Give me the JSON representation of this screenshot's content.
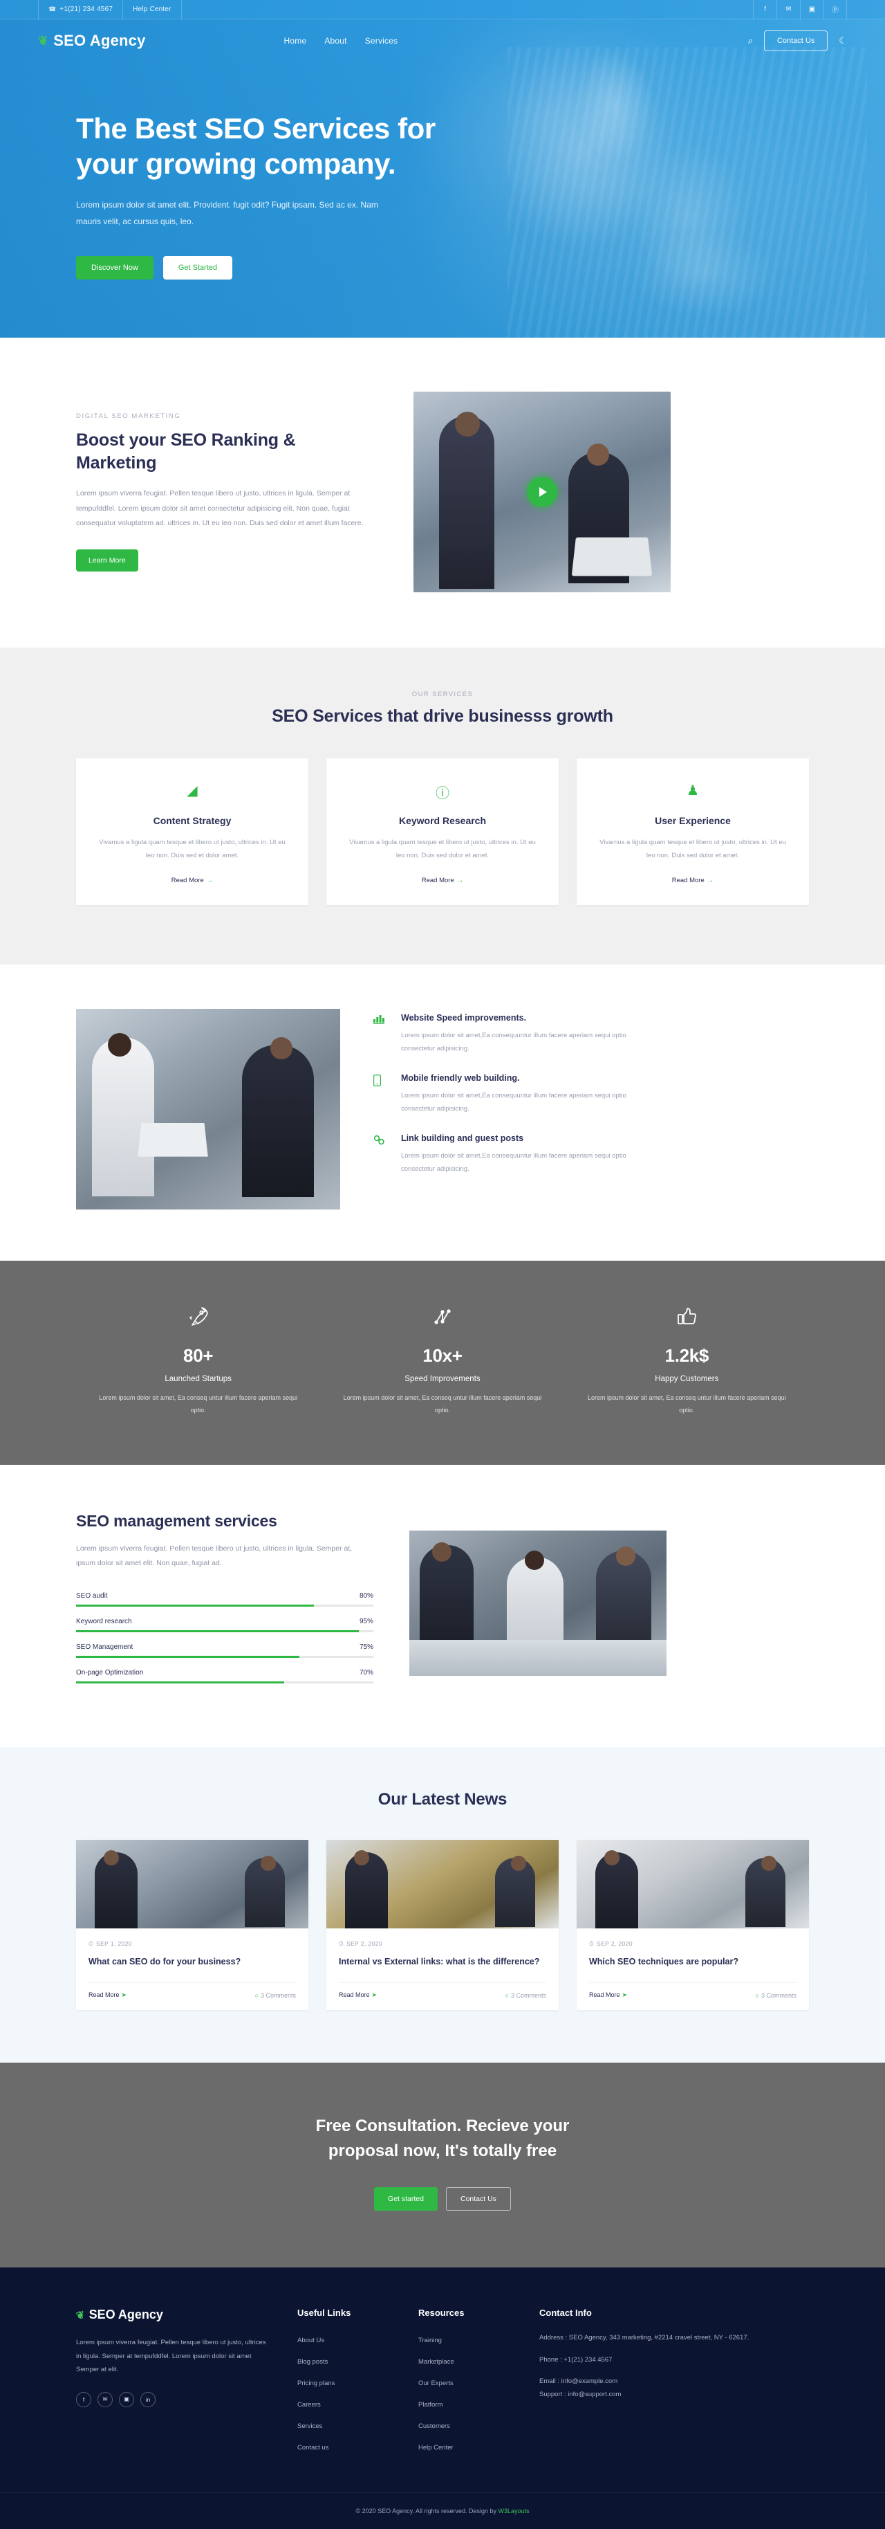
{
  "topbar": {
    "phone": "+1(21) 234 4567",
    "phone_icon": "phone-icon",
    "help": "Help Center",
    "social": [
      {
        "name": "facebook-icon",
        "glyph": "f"
      },
      {
        "name": "twitter-icon",
        "glyph": "✉"
      },
      {
        "name": "instagram-icon",
        "glyph": "▣"
      },
      {
        "name": "pinterest-icon",
        "glyph": "Ⓟ"
      }
    ]
  },
  "nav": {
    "brand": "SEO Agency",
    "leaf_icon": "❦",
    "menu": [
      {
        "label": "Home"
      },
      {
        "label": "About"
      },
      {
        "label": "Services"
      }
    ],
    "search_icon": "⌕",
    "contact_button": "Contact Us",
    "theme_toggle_icon": "☾"
  },
  "hero": {
    "title_line1": "The Best SEO Services for",
    "title_line2": "your growing company.",
    "paragraph": "Lorem ipsum dolor sit amet elit. Provident. fugit odit? Fugit ipsam. Sed ac ex. Nam mauris velit, ac cursus quis, leo.",
    "primary_button": "Discover Now",
    "secondary_button": "Get Started"
  },
  "boost": {
    "eyebrow": "DIGITAL SEO MARKETING",
    "title": "Boost your SEO Ranking & Marketing",
    "paragraph": "Lorem ipsum viverra feugiat. Pellen tesque libero ut justo, ultrices in ligula. Semper at tempufddfel. Lorem ipsum dolor sit amet consectetur adipisicing elit. Non quae, fugiat consequatur voluptatem ad. ultrices in. Ut eu leo non. Duis sed dolor et amet illum facere.",
    "button": "Learn More",
    "play_icon": "play-icon"
  },
  "services": {
    "eyebrow": "OUR SERVICES",
    "title": "SEO Services that drive businesss growth",
    "cards": [
      {
        "icon": "chart-area-icon",
        "glyph": "◢",
        "title": "Content Strategy",
        "text": "Vivamus a ligula quam tesque et libero ut justo, ultrices in. Ut eu leo non. Duis sed et dolor amet.",
        "link": "Read More"
      },
      {
        "icon": "info-circle-icon",
        "glyph": "ⓘ",
        "title": "Keyword Research",
        "text": "Vivamus a ligula quam tesque et libero ut justo, ultrices in. Ut eu leo non. Duis sed dolor et amet.",
        "link": "Read More"
      },
      {
        "icon": "user-icon",
        "glyph": "♟",
        "title": "User Experience",
        "text": "Vivamus a ligula quam tesque et libero ut justo, ultrices in. Ut eu leo non. Duis sed dolor et amet.",
        "link": "Read More"
      }
    ]
  },
  "features": [
    {
      "icon": "bar-chart-icon",
      "glyph": "█",
      "title": "Website Speed improvements.",
      "text": "Lorem ipsum dolor sit amet,Ea consequuntur illum facere aperiam sequi optio consectetur adipisicing."
    },
    {
      "icon": "mobile-phone-icon",
      "glyph": "▯",
      "title": "Mobile friendly web building.",
      "text": "Lorem ipsum dolor sit amet,Ea consequuntur illum facere aperiam sequi optio consectetur adipisicing."
    },
    {
      "icon": "link-chain-icon",
      "glyph": "⛓",
      "title": "Link building and guest posts",
      "text": "Lorem ipsum dolor sit amet,Ea consequuntur illum facere aperiam sequi optio consectetur adipisicing."
    }
  ],
  "stats": [
    {
      "icon": "rocket-icon",
      "glyph": "✈",
      "number": "80+",
      "label": "Launched Startups",
      "desc": "Lorem ipsum dolor sit amet, Ea conseq untur illum facere aperiam sequi optio."
    },
    {
      "icon": "network-nodes-icon",
      "glyph": "∴",
      "number": "10x+",
      "label": "Speed Improvements",
      "desc": "Lorem ipsum dolor sit amet, Ea conseq untur illum facere aperiam sequi optio."
    },
    {
      "icon": "thumbs-up-icon",
      "glyph": "👍",
      "number": "1.2k$",
      "label": "Happy Customers",
      "desc": "Lorem ipsum dolor sit amet, Ea conseq untur illum facere aperiam sequi optio."
    }
  ],
  "management": {
    "title": "SEO management services",
    "paragraph": "Lorem ipsum viverra feugiat. Pellen tesque libero ut justo, ultrices in ligula. Semper at, ipsum dolor sit amet elit. Non quae, fugiat ad.",
    "bars": [
      {
        "label": "SEO audit",
        "pct": "80%",
        "value": 80
      },
      {
        "label": "Keyword research",
        "pct": "95%",
        "value": 95
      },
      {
        "label": "SEO Management",
        "pct": "75%",
        "value": 75
      },
      {
        "label": "On-page Optimization",
        "pct": "70%",
        "value": 70
      }
    ]
  },
  "news": {
    "title": "Our Latest News",
    "posts": [
      {
        "date": "SEP 1, 2020",
        "title": "What can SEO do for your business?",
        "read_more": "Read More",
        "comments": "3 Comments"
      },
      {
        "date": "SEP 2, 2020",
        "title": "Internal vs External links: what is the difference?",
        "read_more": "Read More",
        "comments": "3 Comments"
      },
      {
        "date": "SEP 2, 2020",
        "title": "Which SEO techniques are popular?",
        "read_more": "Read More",
        "comments": "3 Comments"
      }
    ]
  },
  "cta": {
    "line1": "Free Consultation. Recieve your",
    "line2": "proposal now, It's totally free",
    "primary_button": "Get started",
    "secondary_button": "Contact Us"
  },
  "footer": {
    "brand": "SEO Agency",
    "leaf_icon": "❦",
    "about": "Lorem ipsum viverra feugiat. Pellen tesque libero ut justo, ultrices in ligula. Semper at tempufddfel. Lorem ipsum dolor sit amet Semper at elit.",
    "social": [
      {
        "name": "facebook-icon",
        "glyph": "f"
      },
      {
        "name": "twitter-icon",
        "glyph": "✉"
      },
      {
        "name": "instagram-icon",
        "glyph": "▣"
      },
      {
        "name": "linkedin-icon",
        "glyph": "in"
      }
    ],
    "useful_links": {
      "title": "Useful Links",
      "items": [
        "About Us",
        "Blog posts",
        "Pricing plans",
        "Careers",
        "Services",
        "Contact us"
      ]
    },
    "resources": {
      "title": "Resources",
      "items": [
        "Training",
        "Marketplace",
        "Our Experts",
        "Platform",
        "Customers",
        "Help Center"
      ]
    },
    "contact": {
      "title": "Contact Info",
      "address": "Address : SEO Agency, 343 marketing, #2214 cravel street, NY - 62617.",
      "phone": "Phone : +1(21) 234 4567",
      "email": "Email : info@example.com",
      "support": "Support : info@support.com"
    },
    "copyright": "© 2020 SEO Agency. All rights reserved. Design by ",
    "designer": "W3Layouts"
  },
  "colors": {
    "brand_blue": "#2e9ade",
    "accent_green": "#2fb844",
    "dark_navy": "#0b1532",
    "gray_section": "#6b6b6b"
  }
}
